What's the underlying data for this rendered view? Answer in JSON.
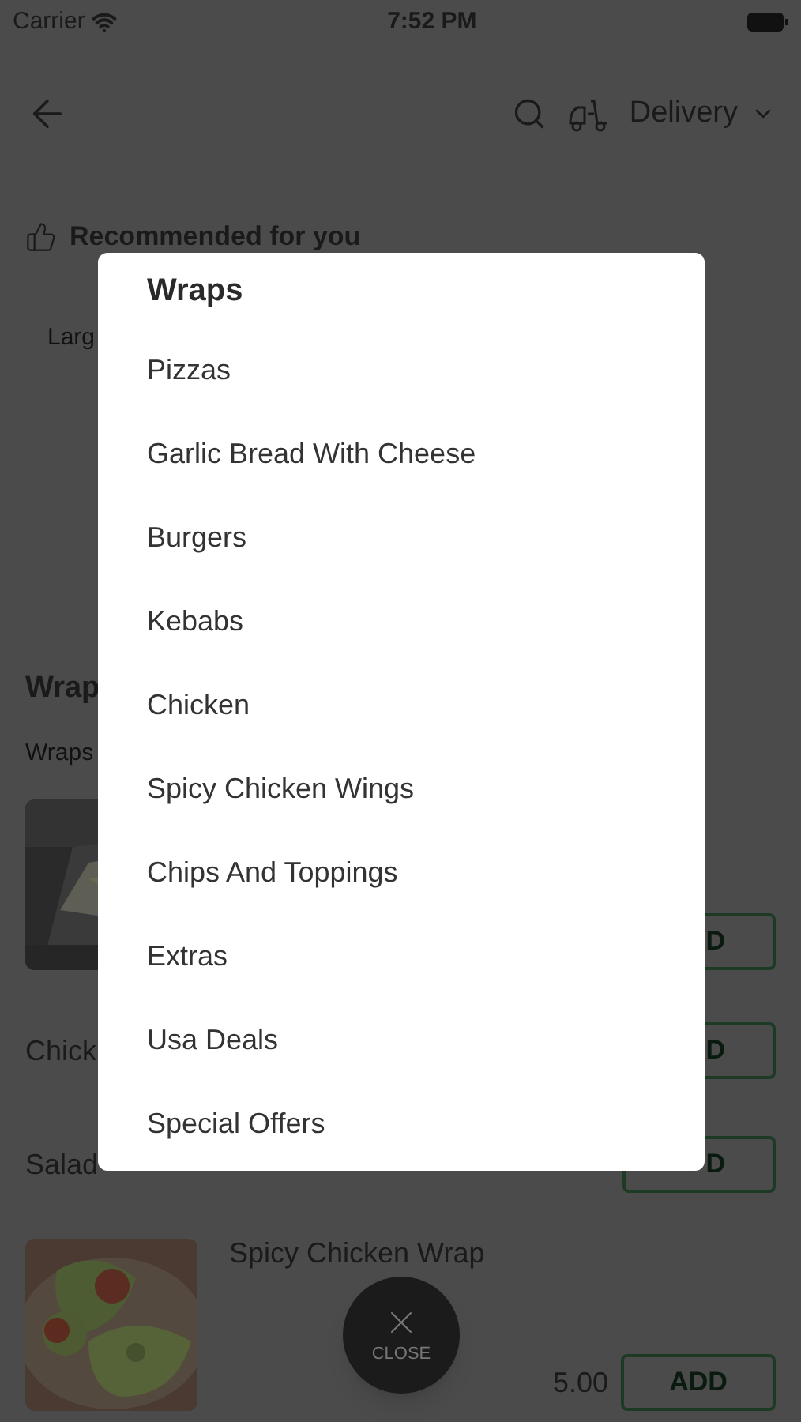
{
  "status_bar": {
    "carrier": "Carrier",
    "time": "7:52 PM"
  },
  "header": {
    "delivery_mode": "Delivery"
  },
  "recommended": {
    "title": "Recommended for you",
    "item": "Larg"
  },
  "section": {
    "title": "Wrap",
    "subtitle": "Wraps"
  },
  "menu_items": [
    {
      "add": "D"
    },
    {
      "kind": "text",
      "name": "Chick",
      "add": "D"
    },
    {
      "kind": "text",
      "name": "Salad",
      "add": "D"
    },
    {
      "name": "Spicy Chicken Wrap",
      "price": "5.00",
      "add": "ADD"
    }
  ],
  "category_modal": {
    "title": "Wraps",
    "categories": [
      "Pizzas",
      "Garlic Bread With Cheese",
      "Burgers",
      "Kebabs",
      "Chicken",
      "Spicy Chicken Wings",
      "Chips And Toppings",
      "Extras",
      "Usa Deals",
      "Special Offers"
    ]
  },
  "close_button": {
    "label": "CLOSE"
  }
}
